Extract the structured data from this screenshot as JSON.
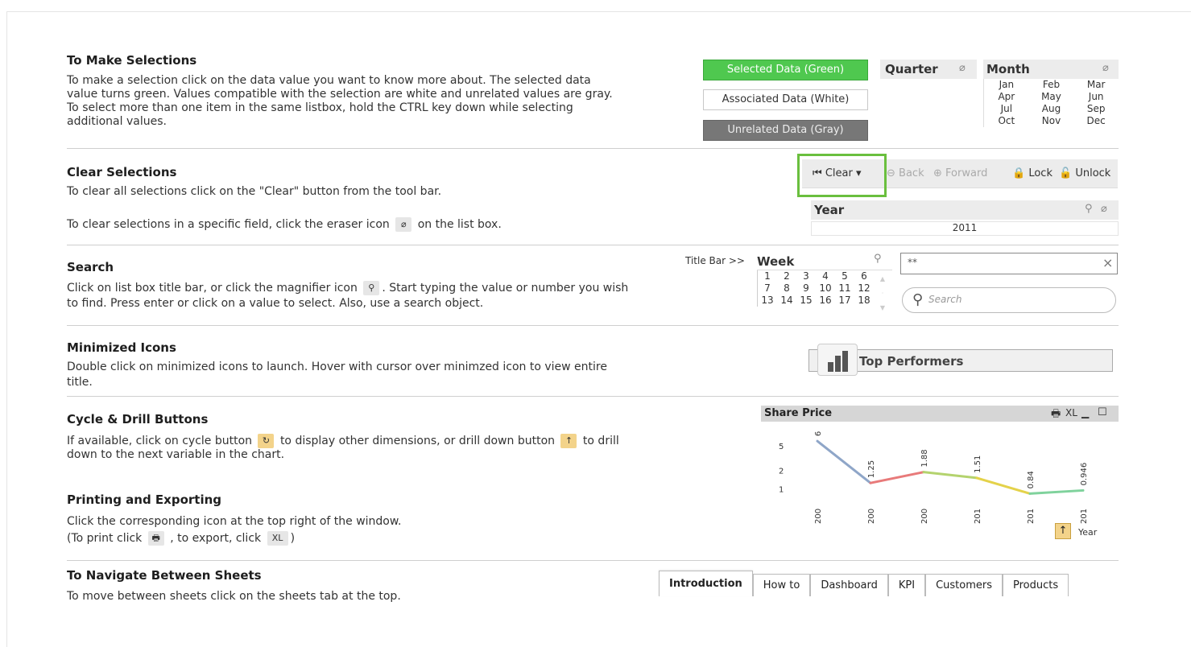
{
  "sections": {
    "selections": {
      "title": "To Make Selections",
      "lines": [
        "To make a selection click on the data value you want to know more about. The selected data",
        "value turns green. Values compatible with the selection are white and unrelated values are gray.",
        "To select more than one item in the same listbox, hold the CTRL key down while selecting",
        "additional values."
      ]
    },
    "clear": {
      "title": "Clear Selections",
      "line1": "To clear all selections click on the \"Clear\" button from the tool bar.",
      "line2_pre": "To clear selections in a specific field, click the eraser icon",
      "line2_post": "on the list box."
    },
    "search": {
      "title": "Search",
      "line1_pre": "Click on list box title bar, or click the magnifier icon",
      "line1_post": ". Start typing the value or number you wish",
      "line2": "to find. Press enter or click on a value to select.  Also, use a search object."
    },
    "minimized": {
      "title": "Minimized Icons",
      "line1": "Double click on minimized icons to launch. Hover with cursor over minimzed icon to view entire",
      "line2": "title."
    },
    "cycle": {
      "title": "Cycle & Drill Buttons",
      "line1_pre": "If available, click on cycle button",
      "line1_mid": "to display other dimensions, or drill down button",
      "line1_post": "to drill",
      "line2": "down to the next variable in the chart."
    },
    "printing": {
      "title": "Printing and Exporting",
      "line1": "Click the corresponding icon at the top right of the window.",
      "line2_pre": "(To print click",
      "line2_mid": ", to export, click",
      "line2_post": ")",
      "xl_label": "XL"
    },
    "navigate": {
      "title": "To Navigate Between Sheets",
      "line1": "To move between sheets click on the sheets tab at the top."
    }
  },
  "legend": {
    "selected": "Selected Data (Green)",
    "associated": "Associated Data (White)",
    "unrelated": "Unrelated Data (Gray)"
  },
  "quarter": {
    "title": "Quarter"
  },
  "month": {
    "title": "Month",
    "values": [
      "Jan",
      "Feb",
      "Mar",
      "Apr",
      "May",
      "Jun",
      "Jul",
      "Aug",
      "Sep",
      "Oct",
      "Nov",
      "Dec"
    ]
  },
  "toolbar": {
    "clear": "Clear",
    "back": "Back",
    "forward": "Forward",
    "lock": "Lock",
    "unlock": "Unlock"
  },
  "year_box": {
    "title": "Year",
    "value": "2011"
  },
  "week_box": {
    "label_prefix": "Title Bar >>",
    "title": "Week",
    "values": [
      "1",
      "2",
      "3",
      "4",
      "5",
      "6",
      "7",
      "8",
      "9",
      "10",
      "11",
      "12",
      "13",
      "14",
      "15",
      "16",
      "17",
      "18"
    ]
  },
  "search_input": {
    "value": "**",
    "placeholder": "Search"
  },
  "minimized_icon": {
    "label": "Top Performers"
  },
  "chart": {
    "title": "Share Price",
    "xl_label": "XL",
    "dimension_label": "Year",
    "y_ticks": [
      "5",
      "2",
      "1"
    ],
    "x_ticks": [
      "200",
      "200",
      "200",
      "201",
      "201",
      "201"
    ]
  },
  "chart_data": {
    "type": "line",
    "title": "Share Price",
    "xlabel": "Year",
    "ylabel": "",
    "y_scale": "log",
    "x": [
      "200",
      "200",
      "200",
      "201",
      "201",
      "201"
    ],
    "values": [
      6,
      1.25,
      1.88,
      1.51,
      0.84,
      0.946
    ],
    "data_labels": [
      "6",
      "1.25",
      "1.88",
      "1.51",
      "0.84",
      "0.946"
    ],
    "segment_colors": [
      "#8fa6c8",
      "#e87a7a",
      "#b4d36e",
      "#e4d24a",
      "#7fd29c"
    ]
  },
  "tabs": [
    "Introduction",
    "How to",
    "Dashboard",
    "KPI",
    "Customers",
    "Products"
  ],
  "colors": {
    "selected": "#4fc84f",
    "unrelated": "#777777",
    "highlight": "#6abf3e"
  }
}
